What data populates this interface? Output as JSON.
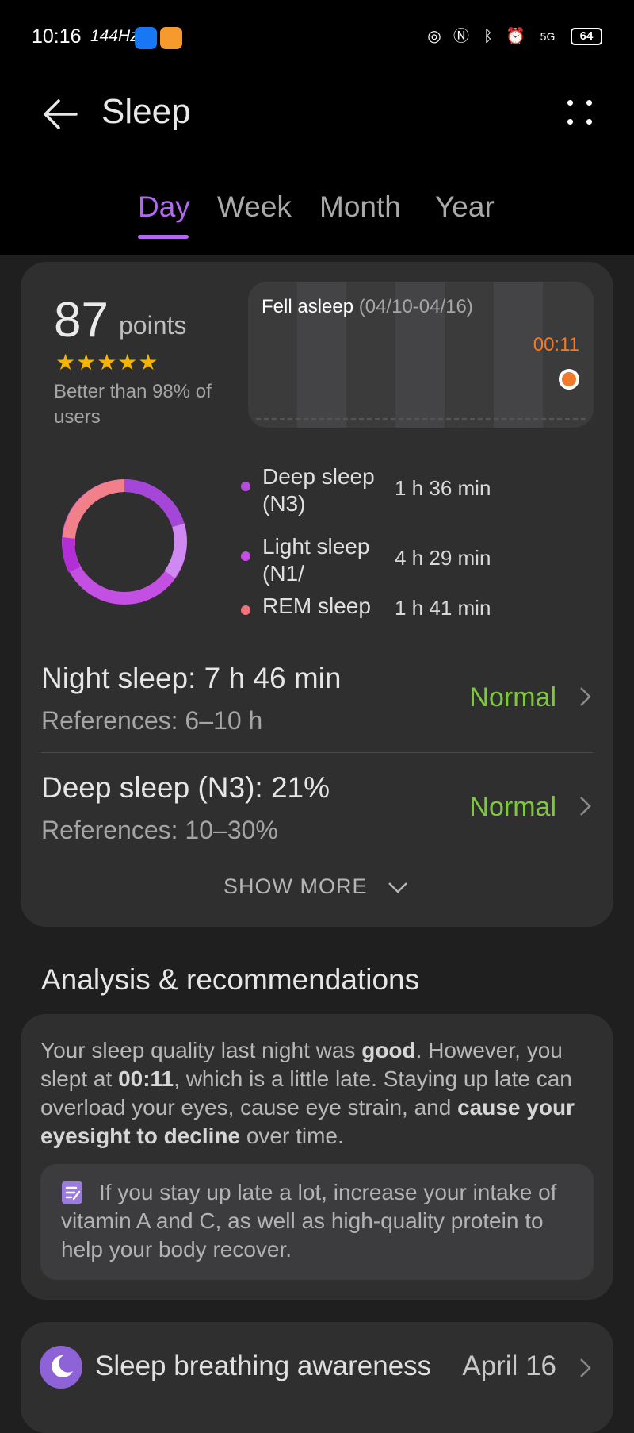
{
  "status_bar": {
    "time": "10:16",
    "refresh": "144Hz",
    "battery": "64",
    "network": "5G"
  },
  "header": {
    "title": "Sleep"
  },
  "tabs": [
    {
      "label": "Day",
      "active": true
    },
    {
      "label": "Week",
      "active": false
    },
    {
      "label": "Month",
      "active": false
    },
    {
      "label": "Year",
      "active": false
    }
  ],
  "summary": {
    "score": "87",
    "score_unit": "points",
    "stars": "★★★★★",
    "rating": 4.5,
    "comparison": "Better than 98% of users",
    "fell_asleep": {
      "label": "Fell asleep",
      "range": "(04/10-04/16)",
      "time": "00:11"
    },
    "stages": [
      {
        "name": "Deep sleep (N3)",
        "value": "1 h 36 min",
        "color": "#b34ddb"
      },
      {
        "name": "Light sleep (N1/",
        "value": "4 h 29 min",
        "color": "#c84de6"
      },
      {
        "name": "REM sleep",
        "value": "1 h 41 min",
        "color": "#f2737a"
      }
    ],
    "metrics": [
      {
        "title": "Night sleep: 7 h 46 min",
        "reference": "References: 6–10 h",
        "status": "Normal"
      },
      {
        "title": "Deep sleep (N3): 21%",
        "reference": "References: 10–30%",
        "status": "Normal"
      }
    ],
    "show_more": "SHOW MORE"
  },
  "analysis": {
    "section_title": "Analysis & recommendations",
    "p1": "Your sleep quality last night was ",
    "b1": "good",
    "p2": ". However, you slept at ",
    "b2": "00:11",
    "p3": ", which is a little late. Staying up late can overload your eyes, cause eye strain, and ",
    "b3": "cause your eyesight to decline",
    "p4": " over time.",
    "tip": "If you stay up late a lot, increase your intake of vitamin A and C, as well as high-quality protein to help your body recover."
  },
  "breathing": {
    "title": "Sleep breathing awareness",
    "date": "April 16"
  },
  "colors": {
    "accent": "#b368f0",
    "normal": "#7ec83c",
    "fell_asleep": "#f07a2a"
  }
}
